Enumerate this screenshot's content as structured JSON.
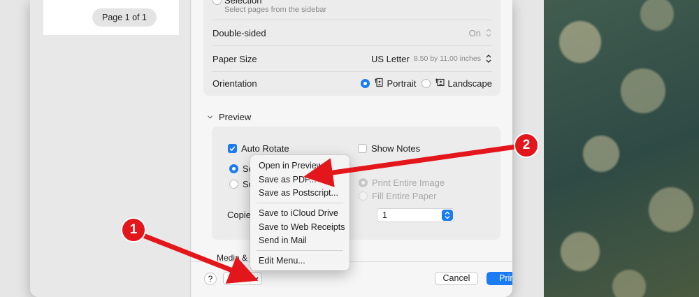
{
  "sidebar": {
    "page_indicator": "Page 1 of 1"
  },
  "options": {
    "selection_label": "Selection",
    "selection_hint": "Select pages from the sidebar",
    "double_sided": {
      "label": "Double-sided",
      "value": "On"
    },
    "paper_size": {
      "label": "Paper Size",
      "value": "US Letter",
      "dims": "8.50 by 11.00 inches"
    },
    "orientation": {
      "label": "Orientation",
      "portrait": "Portrait",
      "landscape": "Landscape",
      "selected": "Portrait"
    }
  },
  "preview": {
    "title": "Preview",
    "auto_rotate": "Auto Rotate",
    "show_notes": "Show Notes",
    "scale_a": "Sc",
    "scale_b": "Sc",
    "print_entire_image": "Print Entire Image",
    "fill_entire_paper": "Fill Entire Paper",
    "copies_label": "Copies",
    "copies_value": "1",
    "media_label": "Media & "
  },
  "footer": {
    "help": "?",
    "pdf": "PDF",
    "cancel": "Cancel",
    "print": "Print"
  },
  "pdf_menu": {
    "items": [
      "Open in Preview",
      "Save as PDF...",
      "Save as Postscript...",
      "Save to iCloud Drive",
      "Save to Web Receipts",
      "Send in Mail",
      "Edit Menu..."
    ]
  },
  "annotations": {
    "badge_1": "1",
    "badge_2": "2"
  },
  "colors": {
    "accent": "#1a7bf2",
    "annotation_red": "#e3161b"
  }
}
